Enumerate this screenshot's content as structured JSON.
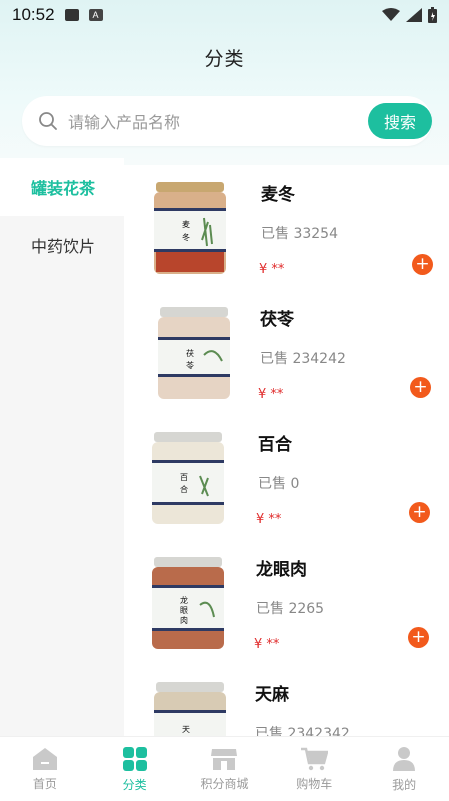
{
  "status": {
    "time": "10:52",
    "icon_a": "A"
  },
  "header": {
    "title": "分类"
  },
  "search": {
    "placeholder": "请输入产品名称",
    "button_label": "搜索"
  },
  "sidebar": {
    "items": [
      {
        "label": "罐装花茶",
        "active": true
      },
      {
        "label": "中药饮片",
        "active": false
      }
    ]
  },
  "products": [
    {
      "name": "麦冬",
      "sold": "已售 33254",
      "price": "¥ **",
      "jar_label": "麦冬"
    },
    {
      "name": "茯苓",
      "sold": "已售 234242",
      "price": "¥ **",
      "jar_label": "茯苓"
    },
    {
      "name": "百合",
      "sold": "已售 0",
      "price": "¥ **",
      "jar_label": "百合"
    },
    {
      "name": "龙眼肉",
      "sold": "已售 2265",
      "price": "¥ **",
      "jar_label": "龙眼肉"
    },
    {
      "name": "天麻",
      "sold": "已售 2342342",
      "price": "",
      "jar_label": "天"
    }
  ],
  "tabbar": {
    "items": [
      {
        "label": "首页",
        "icon": "home-icon"
      },
      {
        "label": "分类",
        "icon": "category-icon",
        "active": true
      },
      {
        "label": "积分商城",
        "icon": "store-icon"
      },
      {
        "label": "购物车",
        "icon": "cart-icon"
      },
      {
        "label": "我的",
        "icon": "user-icon"
      }
    ]
  },
  "colors": {
    "accent": "#1dbf9f",
    "price": "#e02b2b",
    "add": "#f25a1c"
  }
}
